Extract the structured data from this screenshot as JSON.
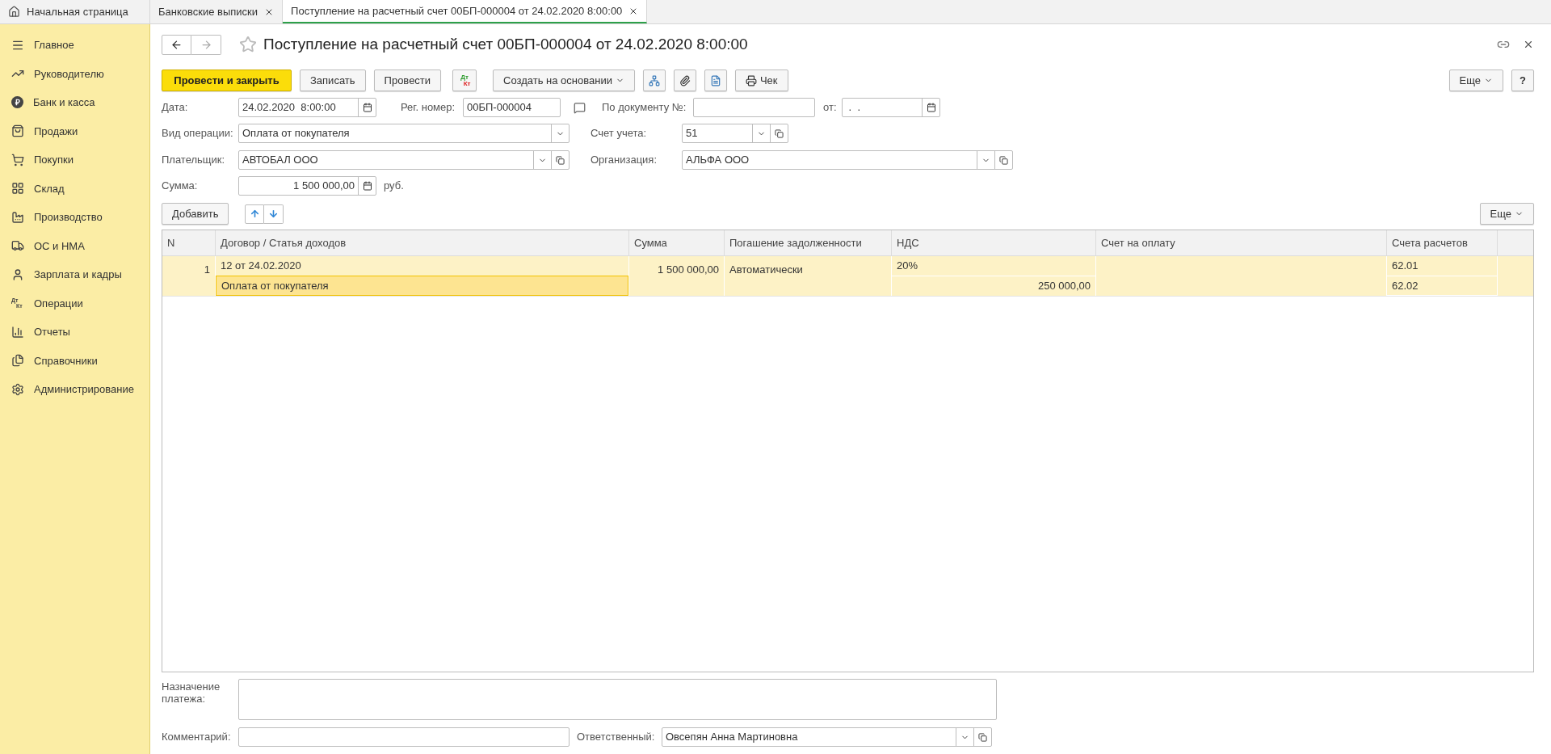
{
  "tabs": [
    {
      "label": "Начальная страница",
      "kind": "home",
      "selected": false
    },
    {
      "label": "Банковские выписки",
      "kind": "closable",
      "selected": false
    },
    {
      "label": "Поступление на расчетный счет 00БП-000004 от 24.02.2020 8:00:00",
      "kind": "closable",
      "selected": true
    }
  ],
  "sidebar": {
    "items": [
      {
        "label": "Главное"
      },
      {
        "label": "Руководителю"
      },
      {
        "label": "Банк и касса",
        "icon_text": "₽"
      },
      {
        "label": "Продажи"
      },
      {
        "label": "Покупки"
      },
      {
        "label": "Склад"
      },
      {
        "label": "Производство"
      },
      {
        "label": "ОС и НМА"
      },
      {
        "label": "Зарплата и кадры"
      },
      {
        "label": "Операции",
        "icon_text": [
          "Дт",
          "Кт"
        ]
      },
      {
        "label": "Отчеты"
      },
      {
        "label": "Справочники"
      },
      {
        "label": "Администрирование"
      }
    ]
  },
  "document": {
    "title": "Поступление на расчетный счет 00БП-000004 от 24.02.2020 8:00:00",
    "favorite": false
  },
  "toolbar": {
    "buttons": [
      {
        "kind": "primary",
        "label": "Провести и закрыть"
      },
      {
        "kind": "plain",
        "label": "Записать"
      },
      {
        "kind": "plain",
        "label": "Провести"
      },
      {
        "kind": "dtkt",
        "labels": [
          "Дт",
          "Кт"
        ]
      },
      {
        "kind": "dropdown",
        "label": "Создать на основании"
      },
      {
        "kind": "structure"
      },
      {
        "kind": "attach"
      },
      {
        "kind": "list"
      },
      {
        "kind": "receipt",
        "label": "Чек"
      }
    ],
    "more": "Еще",
    "help": "?"
  },
  "fields": {
    "date": {
      "label": "Дата:",
      "value": "24.02.2020  8:00:00"
    },
    "reg_number": {
      "label": "Рег. номер:",
      "value": "00БП-000004"
    },
    "doc_number": {
      "label": "По документу №:"
    },
    "doc_date": {
      "label": "от:",
      "value": " .  ."
    },
    "operation": {
      "label": "Вид операции:",
      "value": "Оплата от покупателя"
    },
    "account": {
      "label": "Счет учета:",
      "value": "51"
    },
    "payer": {
      "label": "Плательщик:",
      "value": "АВТОБАЛ ООО"
    },
    "organization": {
      "label": "Организация:",
      "value": "АЛЬФА ООО"
    },
    "amount": {
      "label": "Сумма:",
      "value": "1 500 000,00",
      "unit": "руб."
    }
  },
  "table_toolbar": {
    "add": "Добавить",
    "more": "Еще"
  },
  "table": {
    "columns": [
      "N",
      "Договор / Статья доходов",
      "Сумма",
      "Погашение задолженности",
      "НДС",
      "Счет на оплату",
      "Счета расчетов"
    ],
    "rows": [
      {
        "selected": true,
        "number": "1",
        "contract": "12 от 24.02.2020",
        "item": "Оплата от покупателя",
        "item_focused": true,
        "amount": "1 500 000,00",
        "repayment": "Автоматически",
        "vat_rate": "20%",
        "vat_amount": "250 000,00",
        "accounts": [
          "62.01",
          "62.02"
        ]
      }
    ]
  },
  "purpose": {
    "label": "Назначение платежа:"
  },
  "comment": {
    "label": "Комментарий:"
  },
  "responsible": {
    "label": "Ответственный:",
    "value": "Овсепян Анна Мартиновна"
  }
}
